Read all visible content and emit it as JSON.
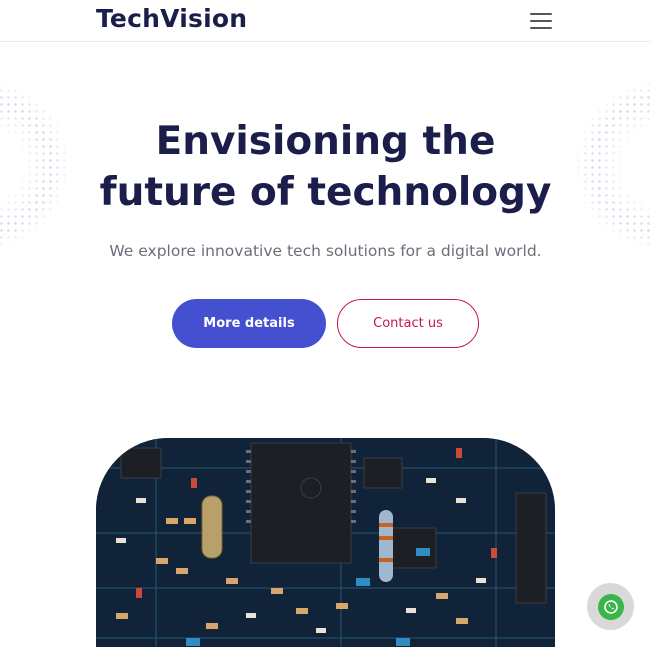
{
  "header": {
    "logo_text": "TechVision",
    "menu_icon": "hamburger-menu-icon"
  },
  "hero": {
    "title_line1": "Envisioning the",
    "title_line2": "future of technology",
    "subtitle": "We explore innovative tech solutions for a digital world.",
    "primary_button": "More details",
    "secondary_button": "Contact us"
  },
  "image": {
    "icon": "circuit-board-image"
  },
  "chat": {
    "icon": "whatsapp-icon"
  },
  "colors": {
    "brand_dark": "#1b1d4b",
    "primary": "#4550d1",
    "accent": "#c2185b",
    "whatsapp": "#3ab54a"
  }
}
